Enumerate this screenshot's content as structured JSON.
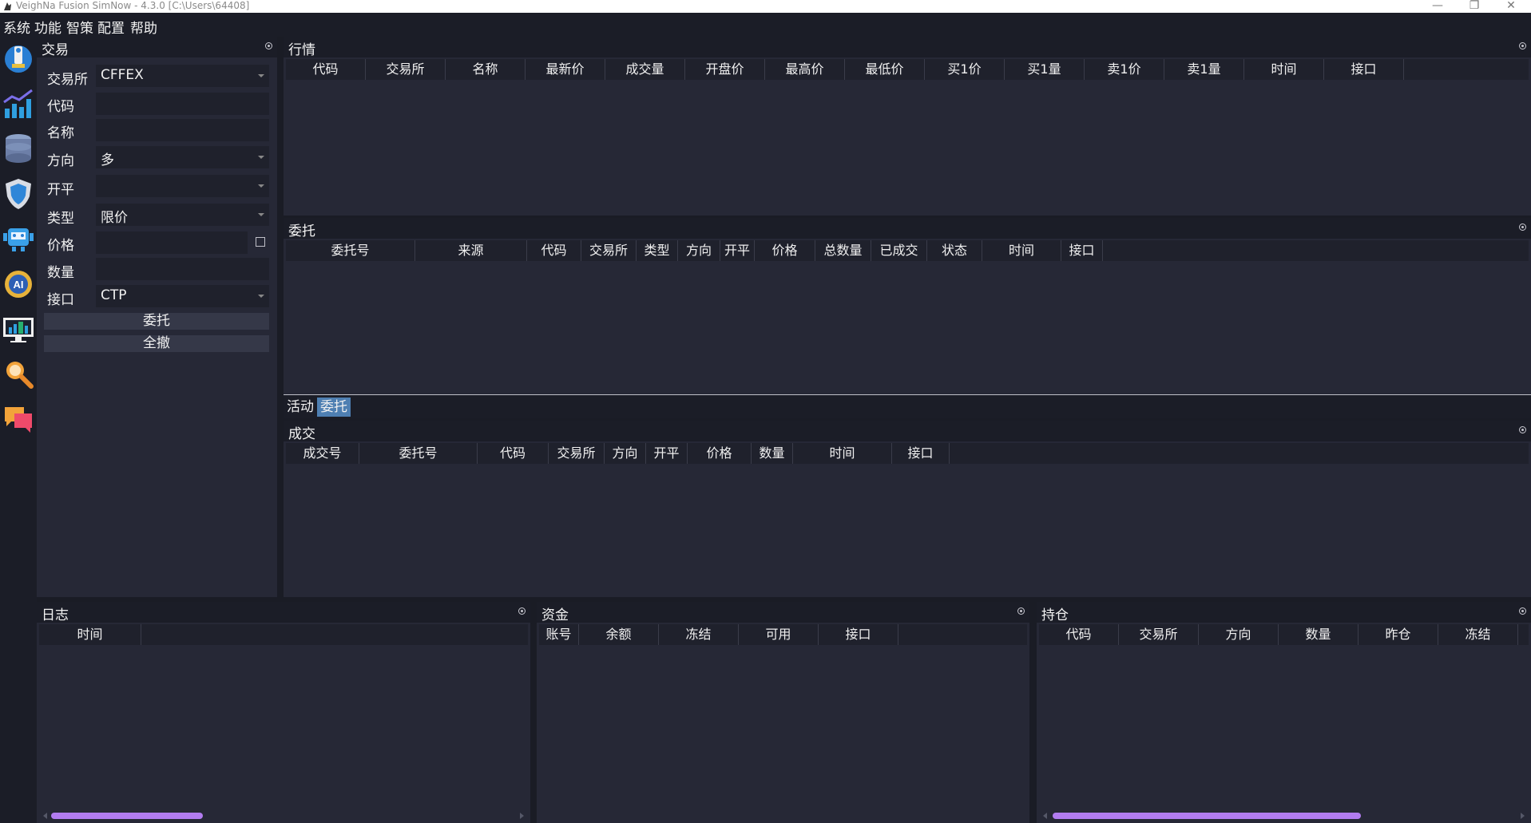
{
  "window": {
    "title": "VeighNa Fusion SimNow - 4.3.0   [C:\\Users\\64408]"
  },
  "menu": [
    "系统",
    "功能",
    "智策",
    "配置",
    "帮助"
  ],
  "toolbar": [
    "chess-icon",
    "chart-icon",
    "database-icon",
    "shield-icon",
    "robot-icon",
    "ai-gear-icon",
    "monitor-icon",
    "search-icon",
    "chat-icon"
  ],
  "trade": {
    "title": "交易",
    "labels": {
      "exchange": "交易所",
      "symbol": "代码",
      "name": "名称",
      "direction": "方向",
      "offset": "开平",
      "type": "类型",
      "price": "价格",
      "volume": "数量",
      "gateway": "接口"
    },
    "values": {
      "exchange": "CFFEX",
      "symbol": "",
      "name": "",
      "direction": "多",
      "offset": "",
      "type": "限价",
      "price": "",
      "volume": "",
      "gateway": "CTP"
    },
    "buttons": {
      "send": "委托",
      "cancel_all": "全撤"
    }
  },
  "tick": {
    "title": "行情",
    "columns": [
      "代码",
      "交易所",
      "名称",
      "最新价",
      "成交量",
      "开盘价",
      "最高价",
      "最低价",
      "买1价",
      "买1量",
      "卖1价",
      "卖1量",
      "时间",
      "接口"
    ]
  },
  "order": {
    "title": "委托",
    "columns": [
      "委托号",
      "来源",
      "代码",
      "交易所",
      "类型",
      "方向",
      "开平",
      "价格",
      "总数量",
      "已成交",
      "状态",
      "时间",
      "接口"
    ]
  },
  "tabs": [
    "活动",
    "委托"
  ],
  "trade_list": {
    "title": "成交",
    "columns": [
      "成交号",
      "委托号",
      "代码",
      "交易所",
      "方向",
      "开平",
      "价格",
      "数量",
      "时间",
      "接口"
    ]
  },
  "log": {
    "title": "日志",
    "columns": [
      "时间"
    ]
  },
  "account": {
    "title": "资金",
    "columns": [
      "账号",
      "余额",
      "冻结",
      "可用",
      "接口"
    ]
  },
  "position": {
    "title": "持仓",
    "columns": [
      "代码",
      "交易所",
      "方向",
      "数量",
      "昨仓",
      "冻结"
    ]
  }
}
